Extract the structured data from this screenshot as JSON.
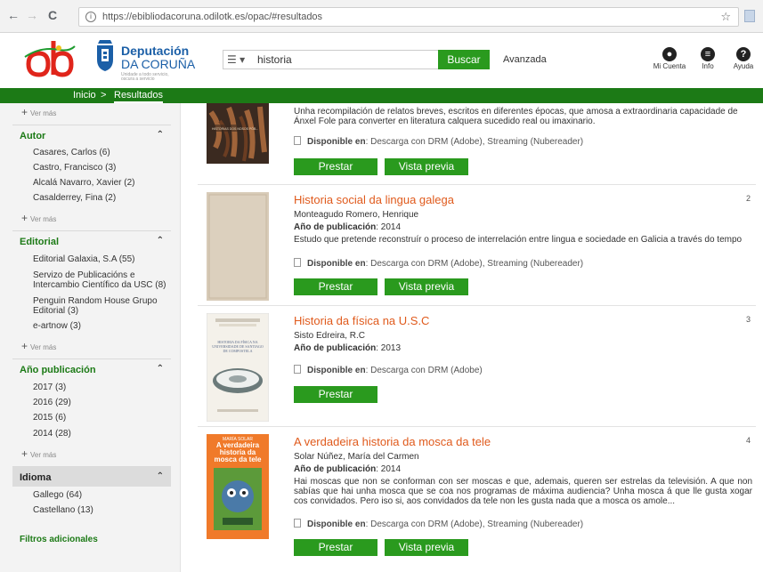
{
  "browser": {
    "url": "https://ebibliodacoruna.odilotk.es/opac/#resultados",
    "back_glyph": "←",
    "forward_glyph": "→",
    "reload_glyph": "C",
    "info_glyph": "i",
    "star_glyph": "☆"
  },
  "header": {
    "brand_name_line1": "Deputación",
    "brand_name_line2": "DA CORUÑA",
    "brand_tagline": "Unidade a todo servicio, oscura a servicio",
    "search": {
      "mode_icon": "☰ ▾",
      "value": "historia",
      "button_label": "Buscar"
    },
    "advanced_label": "Avanzada",
    "icons": [
      {
        "label": "Mi Cuenta",
        "glyph": "●"
      },
      {
        "label": "Info",
        "glyph": "≡"
      },
      {
        "label": "Ayuda",
        "glyph": "?"
      }
    ]
  },
  "navbar": {
    "home": "Inicio",
    "separator": ">",
    "current": "Resultados"
  },
  "sidebar": {
    "more_label": "Ver más",
    "sections": {
      "autor": {
        "title": "Autor",
        "items": [
          "Casares, Carlos (6)",
          "Castro, Francisco (3)",
          "Alcalá Navarro, Xavier (2)",
          "Casalderrey, Fina (2)"
        ]
      },
      "editorial": {
        "title": "Editorial",
        "items": [
          "Editorial Galaxia, S.A (55)",
          "Servizo de Publicacións e Intercambio Científico da USC (8)",
          "Penguin Random House Grupo Editorial (3)",
          "e-artnow (3)"
        ]
      },
      "ano": {
        "title": "Año publicación",
        "items": [
          "2017 (3)",
          "2016 (29)",
          "2015 (6)",
          "2014 (28)"
        ]
      },
      "idioma": {
        "title": "Idioma",
        "items": [
          "Gallego (64)",
          "Castellano (13)"
        ]
      }
    },
    "extra_filters": "Filtros adicionales"
  },
  "results": {
    "avail_label": "Disponible en",
    "year_label": "Año de publicación",
    "lend_label": "Prestar",
    "preview_label": "Vista previa",
    "items": [
      {
        "description": "Unha recompilación de relatos breves, escritos en diferentes épocas, que amosa a extraordinaria capacidade de Ánxel Fole para converter en literatura calquera sucedido real ou imaxinario.",
        "availability": "Descarga con DRM (Adobe), Streaming (Nubereader)",
        "cover_text": "HISTORIAS DOS NOSOS PÓB..."
      },
      {
        "title": "Historia social da lingua galega",
        "author": "Monteagudo Romero, Henrique",
        "year": "2014",
        "description": "Estudo que pretende reconstruír o proceso de interrelación entre lingua e sociedade en Galicia a través do tempo",
        "availability": "Descarga con DRM (Adobe), Streaming (Nubereader)",
        "number": "2"
      },
      {
        "title": "Historia da física na U.S.C",
        "author": "Sisto Edreira, R.C",
        "year": "2013",
        "availability": "Descarga con DRM (Adobe)",
        "number": "3",
        "cover_text": "HISTORIA DA FÍSICA NA UNIVERSIDADE DE SANTIAGO DE COMPOSTELA"
      },
      {
        "title": "A verdadeira historia da mosca da tele",
        "author": "Solar Núñez, María del Carmen",
        "year": "2014",
        "description": "Hai moscas que non se conforman con ser moscas e que, ademais, queren ser estrelas da televisión. A que non sabías que hai unha mosca que se coa nos programas de máxima audiencia? Unha mosca á que lle gusta xogar cos convidados. Pero iso si, aos convidados da tele non les gusta nada que a mosca os amole...",
        "availability": "Descarga con DRM (Adobe), Streaming (Nubereader)",
        "number": "4",
        "cover_text_top": "MARÍA SOLAR",
        "cover_text": "A verdadeira historia da mosca da tele"
      }
    ]
  },
  "colors": {
    "brand_green": "#1c7a16",
    "button_green": "#2a9a1e",
    "title_orange": "#e05a1c",
    "brand_blue": "#1b5fa7"
  }
}
